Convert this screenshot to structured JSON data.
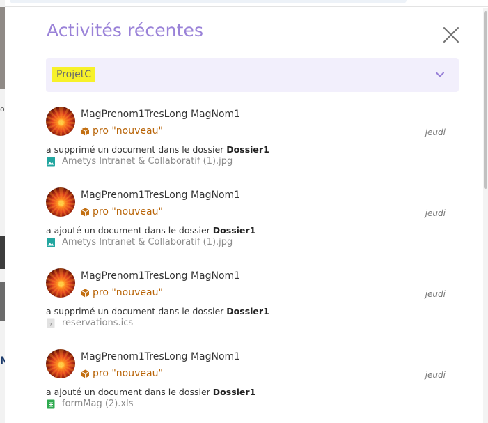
{
  "panel": {
    "title": "Activités récentes",
    "close_label": "Fermer"
  },
  "filter": {
    "selected": "ProjetC"
  },
  "activities": [
    {
      "user": "MagPrenom1TresLong MagNom1",
      "project": "pro \"nouveau\"",
      "date": "jeudi",
      "action": "a supprimé un document dans le dossier",
      "folder": "Dossier1",
      "file": "Ametys Intranet & Collaboratif (1).jpg",
      "file_icon": "image-file-icon"
    },
    {
      "user": "MagPrenom1TresLong MagNom1",
      "project": "pro \"nouveau\"",
      "date": "jeudi",
      "action": "a ajouté un document dans le dossier",
      "folder": "Dossier1",
      "file": "Ametys Intranet & Collaboratif (1).jpg",
      "file_icon": "image-file-icon"
    },
    {
      "user": "MagPrenom1TresLong MagNom1",
      "project": "pro \"nouveau\"",
      "date": "jeudi",
      "action": "a supprimé un document dans le dossier",
      "folder": "Dossier1",
      "file": "reservations.ics",
      "file_icon": "unknown-file-icon"
    },
    {
      "user": "MagPrenom1TresLong MagNom1",
      "project": "pro \"nouveau\"",
      "date": "jeudi",
      "action": "a ajouté un document dans le dossier",
      "folder": "Dossier1",
      "file": "formMag (2).xls",
      "file_icon": "spreadsheet-file-icon"
    }
  ],
  "colors": {
    "title": "#9a82d8",
    "accent": "#9a82d8",
    "project": "#b86408",
    "highlight": "#f7f12a",
    "select_bg": "#f2effc"
  }
}
